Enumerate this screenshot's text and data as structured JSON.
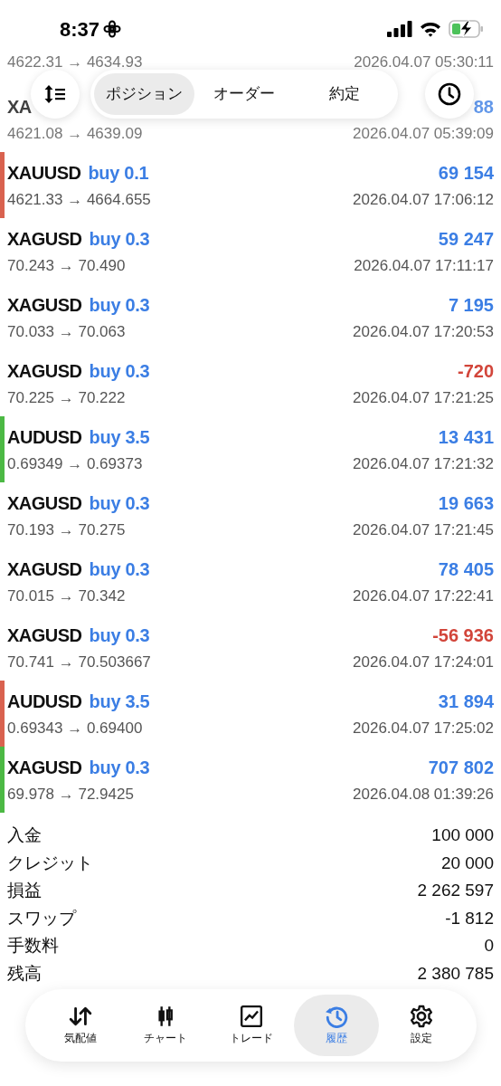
{
  "status_bar": {
    "time": "8:37"
  },
  "segments": [
    {
      "label": "ポジション",
      "selected": true
    },
    {
      "label": "オーダー",
      "selected": false
    },
    {
      "label": "約定",
      "selected": false
    }
  ],
  "trades": [
    {
      "obscured": true,
      "prices": "4622.31 → 4634.93",
      "time": "2026.04.07 05:30:11"
    },
    {
      "obscured": true,
      "symbol": "XA",
      "profit": "88",
      "loss": false,
      "prices": "4621.08 → 4639.09",
      "time": "2026.04.07 05:39:09"
    },
    {
      "obscured": false,
      "symbol": "XAUUSD",
      "side": "buy 0.1",
      "profit": "69 154",
      "loss": false,
      "prices": "4621.33 → 4664.655",
      "time": "2026.04.07 17:06:12",
      "color": "#d9624f"
    },
    {
      "obscured": false,
      "symbol": "XAGUSD",
      "side": "buy 0.3",
      "profit": "59 247",
      "loss": false,
      "prices": "70.243 → 70.490",
      "time": "2026.04.07 17:11:17"
    },
    {
      "obscured": false,
      "symbol": "XAGUSD",
      "side": "buy 0.3",
      "profit": "7 195",
      "loss": false,
      "prices": "70.033 → 70.063",
      "time": "2026.04.07 17:20:53"
    },
    {
      "obscured": false,
      "symbol": "XAGUSD",
      "side": "buy 0.3",
      "profit": "-720",
      "loss": true,
      "prices": "70.225 → 70.222",
      "time": "2026.04.07 17:21:25"
    },
    {
      "obscured": false,
      "symbol": "AUDUSD",
      "side": "buy 3.5",
      "profit": "13 431",
      "loss": false,
      "prices": "0.69349 → 0.69373",
      "time": "2026.04.07 17:21:32",
      "color": "#4cb944"
    },
    {
      "obscured": false,
      "symbol": "XAGUSD",
      "side": "buy 0.3",
      "profit": "19 663",
      "loss": false,
      "prices": "70.193 → 70.275",
      "time": "2026.04.07 17:21:45"
    },
    {
      "obscured": false,
      "symbol": "XAGUSD",
      "side": "buy 0.3",
      "profit": "78 405",
      "loss": false,
      "prices": "70.015 → 70.342",
      "time": "2026.04.07 17:22:41"
    },
    {
      "obscured": false,
      "symbol": "XAGUSD",
      "side": "buy 0.3",
      "profit": "-56 936",
      "loss": true,
      "prices": "70.741 → 70.503667",
      "time": "2026.04.07 17:24:01"
    },
    {
      "obscured": false,
      "symbol": "AUDUSD",
      "side": "buy 3.5",
      "profit": "31 894",
      "loss": false,
      "prices": "0.69343 → 0.69400",
      "time": "2026.04.07 17:25:02",
      "color": "#d9624f"
    },
    {
      "obscured": false,
      "symbol": "XAGUSD",
      "side": "buy 0.3",
      "profit": "707 802",
      "loss": false,
      "prices": "69.978 → 72.9425",
      "time": "2026.04.08 01:39:26",
      "color": "#4cb944"
    }
  ],
  "summary": [
    {
      "label": "入金",
      "value": "100 000"
    },
    {
      "label": "クレジット",
      "value": "20 000"
    },
    {
      "label": "損益",
      "value": "2 262 597"
    },
    {
      "label": "スワップ",
      "value": "-1 812"
    },
    {
      "label": "手数料",
      "value": "0"
    },
    {
      "label": "残高",
      "value": "2 380 785"
    }
  ],
  "tab_bar": [
    {
      "kind": "quotes",
      "label": "気配値",
      "selected": false
    },
    {
      "kind": "chart",
      "label": "チャート",
      "selected": false
    },
    {
      "kind": "trade",
      "label": "トレード",
      "selected": false
    },
    {
      "kind": "history",
      "label": "履歴",
      "selected": true
    },
    {
      "kind": "settings",
      "label": "設定",
      "selected": false
    }
  ]
}
